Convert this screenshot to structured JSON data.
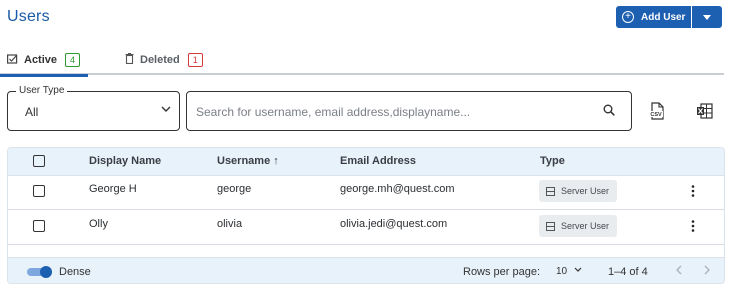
{
  "header": {
    "title": "Users",
    "add_user_label": "Add User"
  },
  "tabs": [
    {
      "label": "Active",
      "count": "4"
    },
    {
      "label": "Deleted",
      "count": "1"
    }
  ],
  "filters": {
    "user_type_label": "User Type",
    "user_type_value": "All",
    "search_placeholder": "Search for username, email address,displayname..."
  },
  "table": {
    "columns": [
      "Display Name",
      "Username ↑",
      "Email Address",
      "Type"
    ],
    "rows": [
      {
        "display_name": "George H",
        "username": "george",
        "email": "george.mh@quest.com",
        "type": "Server User"
      },
      {
        "display_name": "Olly",
        "username": "olivia",
        "email": "olivia.jedi@quest.com",
        "type": "Server User"
      }
    ]
  },
  "footer": {
    "dense_label": "Dense",
    "dense_on": true,
    "rows_per_page_label": "Rows per page:",
    "rows_per_page_value": "10",
    "range": "1–4 of 4"
  },
  "colors": {
    "accent": "#1d5fb0",
    "title": "#1a5aa6",
    "header_bg": "#e8f2fb",
    "active_badge": "#2d9b2d",
    "deleted_badge": "#d23b3b"
  }
}
